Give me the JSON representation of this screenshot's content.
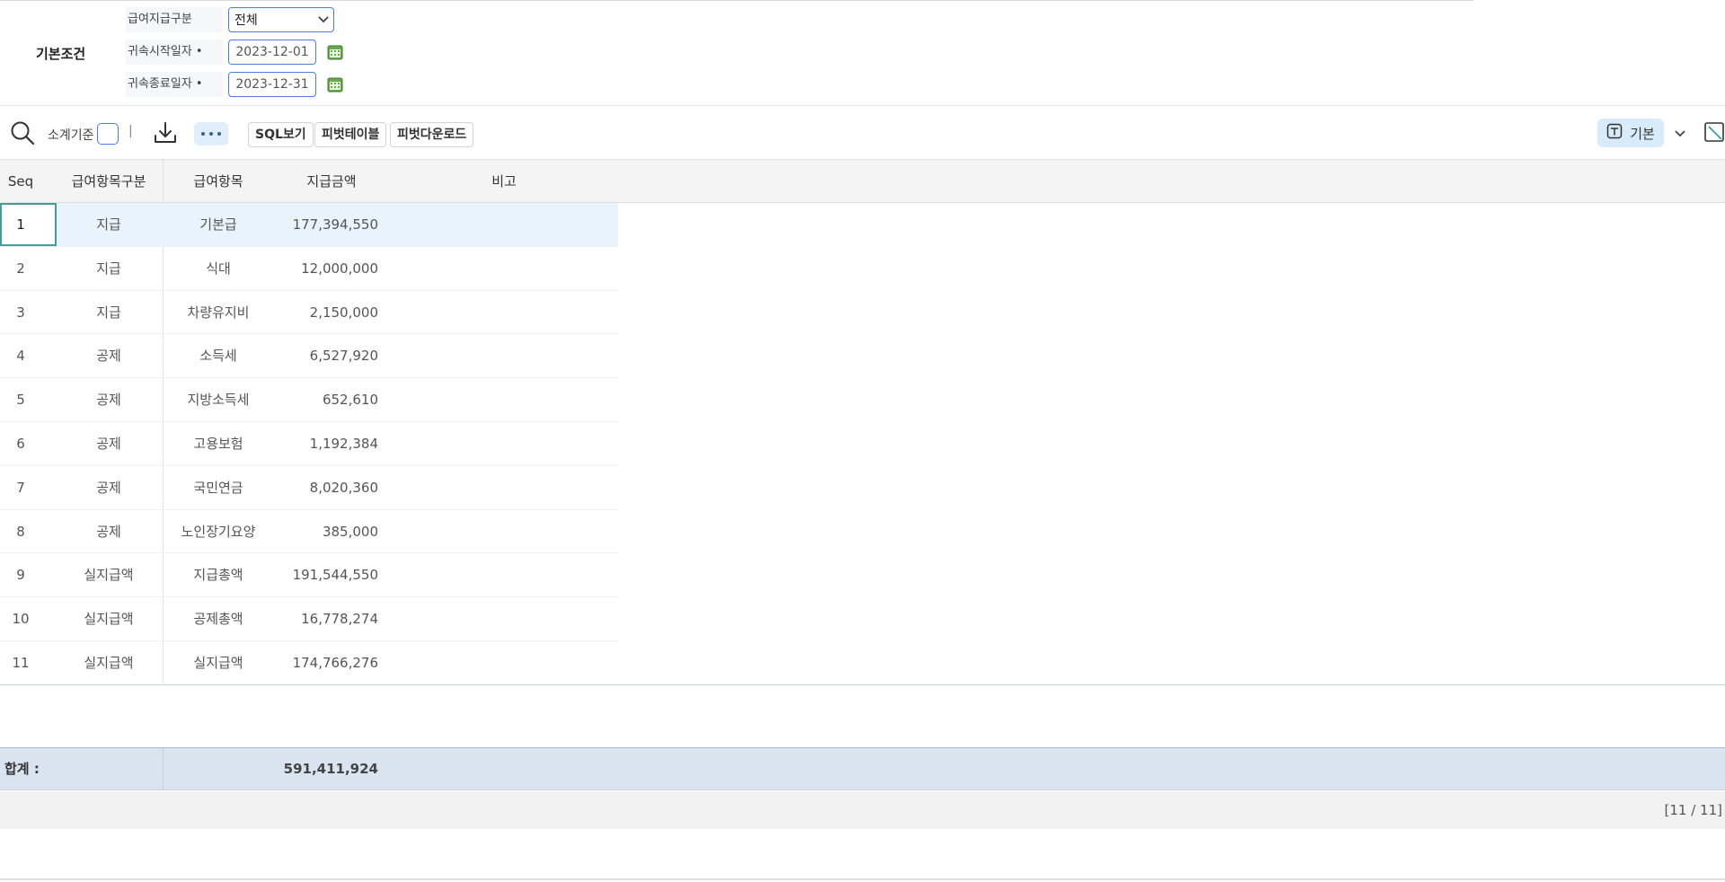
{
  "conditions": {
    "title": "기본조건",
    "pay_type_label": "급여지급구분",
    "pay_type_value": "전체",
    "start_label": "귀속시작일자 •",
    "start_value": "2023-12-01",
    "end_label": "귀속종료일자 •",
    "end_value": "2023-12-31"
  },
  "toolbar": {
    "subtotal_label": "소계기준",
    "separator": "|",
    "sql_label": "SQL보기",
    "pivot_label": "피벗테이블",
    "pivot_download_label": "피벗다운로드",
    "basic_label": "기본"
  },
  "grid": {
    "headers": [
      "Seq",
      "급여항목구분",
      "급여항목",
      "지급금액",
      "비고"
    ],
    "rows": [
      {
        "seq": "1",
        "category": "지급",
        "item": "기본급",
        "amount": "177,394,550"
      },
      {
        "seq": "2",
        "category": "지급",
        "item": "식대",
        "amount": "12,000,000"
      },
      {
        "seq": "3",
        "category": "지급",
        "item": "차량유지비",
        "amount": "2,150,000"
      },
      {
        "seq": "4",
        "category": "공제",
        "item": "소득세",
        "amount": "6,527,920"
      },
      {
        "seq": "5",
        "category": "공제",
        "item": "지방소득세",
        "amount": "652,610"
      },
      {
        "seq": "6",
        "category": "공제",
        "item": "고용보험",
        "amount": "1,192,384"
      },
      {
        "seq": "7",
        "category": "공제",
        "item": "국민연금",
        "amount": "8,020,360"
      },
      {
        "seq": "8",
        "category": "공제",
        "item": "노인장기요양",
        "amount": "385,000"
      },
      {
        "seq": "9",
        "category": "실지급액",
        "item": "지급총액",
        "amount": "191,544,550"
      },
      {
        "seq": "10",
        "category": "실지급액",
        "item": "공제총액",
        "amount": "16,778,274"
      },
      {
        "seq": "11",
        "category": "실지급액",
        "item": "실지급액",
        "amount": "174,766,276"
      }
    ]
  },
  "footer": {
    "sum_label": "합계 :",
    "sum_value": "591,411,924",
    "pager": "[11 / 11]"
  },
  "colors": {
    "accent": "#4a7fe0",
    "selected_row": "#e8f3fb",
    "sum_row": "#d9e4f0",
    "calendar_icon": "#5a9a3c"
  },
  "icons": {
    "search": "search-icon",
    "download": "download-icon",
    "more": "more-icon",
    "calendar": "calendar-icon",
    "basic": "text-frame-icon",
    "chevron": "chevron-down-icon"
  }
}
